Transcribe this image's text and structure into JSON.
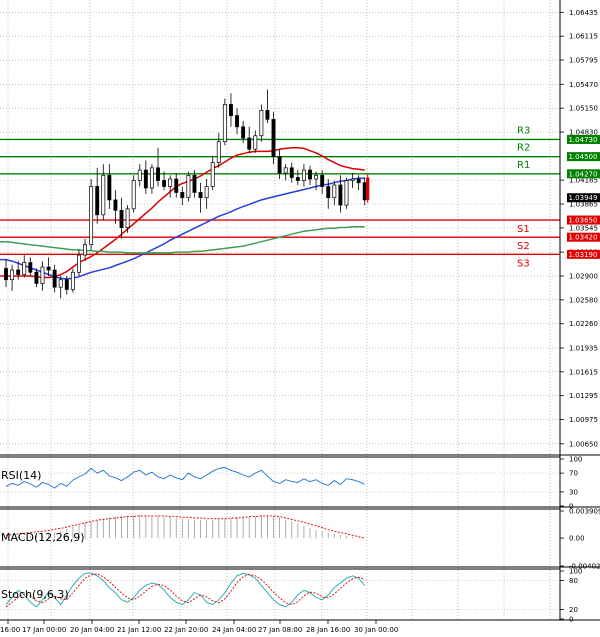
{
  "chart_data": {
    "type": "candlestick",
    "y_axis": {
      "range": [
        1.005,
        1.066
      ],
      "ticks": [
        "1.06435",
        "1.06115",
        "1.05795",
        "1.05470",
        "1.05150",
        "1.04830",
        "1.04185",
        "1.03865",
        "1.03545",
        "1.03220",
        "1.02900",
        "1.02580",
        "1.02260",
        "1.01935",
        "1.01615",
        "1.01295",
        "1.00975",
        "1.00650"
      ]
    },
    "x_axis": {
      "ticks": [
        "16:00",
        "17 Jan 00:00",
        "20 Jan 04:00",
        "21 Jan 12:00",
        "22 Jan 20:00",
        "24 Jan 04:00",
        "27 Jan 08:00",
        "28 Jan 16:00",
        "30 Jan 00:00"
      ]
    },
    "current_price": "1.03949",
    "levels": [
      {
        "name": "R3",
        "value": 1.0473,
        "tag": "1.04730",
        "color": "#008000"
      },
      {
        "name": "R2",
        "value": 1.045,
        "tag": "1.04500",
        "color": "#008000"
      },
      {
        "name": "R1",
        "value": 1.0427,
        "tag": "1.04270",
        "color": "#008000"
      },
      {
        "name": "S1",
        "value": 1.0365,
        "tag": "1.03650",
        "color": "#e00000"
      },
      {
        "name": "S2",
        "value": 1.0342,
        "tag": "1.03420",
        "color": "#e00000"
      },
      {
        "name": "S3",
        "value": 1.0319,
        "tag": "1.03190",
        "color": "#e00000"
      }
    ],
    "candles": [
      [
        1.03,
        1.0312,
        1.0275,
        1.0285
      ],
      [
        1.0285,
        1.0305,
        1.027,
        1.0298
      ],
      [
        1.0298,
        1.031,
        1.0285,
        1.0292
      ],
      [
        1.0292,
        1.0318,
        1.0288,
        1.0308
      ],
      [
        1.0308,
        1.0315,
        1.029,
        1.0295
      ],
      [
        1.0295,
        1.03,
        1.0275,
        1.028
      ],
      [
        1.028,
        1.031,
        1.027,
        1.0302
      ],
      [
        1.0302,
        1.0315,
        1.029,
        1.0298
      ],
      [
        1.0298,
        1.0305,
        1.0268,
        1.0275
      ],
      [
        1.0275,
        1.029,
        1.026,
        1.0285
      ],
      [
        1.0285,
        1.029,
        1.0265,
        1.0272
      ],
      [
        1.0272,
        1.03,
        1.0268,
        1.0295
      ],
      [
        1.0295,
        1.0325,
        1.029,
        1.0318
      ],
      [
        1.0318,
        1.034,
        1.031,
        1.0332
      ],
      [
        1.0332,
        1.042,
        1.0325,
        1.041
      ],
      [
        1.041,
        1.0435,
        1.036,
        1.0372
      ],
      [
        1.0372,
        1.044,
        1.0365,
        1.0425
      ],
      [
        1.0425,
        1.044,
        1.038,
        1.0392
      ],
      [
        1.0392,
        1.0405,
        1.036,
        1.0378
      ],
      [
        1.0378,
        1.0395,
        1.034,
        1.0355
      ],
      [
        1.0355,
        1.0385,
        1.0348,
        1.038
      ],
      [
        1.038,
        1.0425,
        1.0375,
        1.0418
      ],
      [
        1.0418,
        1.044,
        1.041,
        1.0432
      ],
      [
        1.0432,
        1.0445,
        1.04,
        1.0408
      ],
      [
        1.0408,
        1.044,
        1.04,
        1.0435
      ],
      [
        1.0435,
        1.0462,
        1.041,
        1.0418
      ],
      [
        1.0418,
        1.043,
        1.0405,
        1.041
      ],
      [
        1.041,
        1.0425,
        1.0395,
        1.042
      ],
      [
        1.042,
        1.0428,
        1.0395,
        1.0402
      ],
      [
        1.0402,
        1.041,
        1.0385,
        1.0395
      ],
      [
        1.0395,
        1.043,
        1.039,
        1.0425
      ],
      [
        1.0425,
        1.0432,
        1.0395,
        1.0402
      ],
      [
        1.0402,
        1.0415,
        1.0375,
        1.0395
      ],
      [
        1.0395,
        1.042,
        1.038,
        1.041
      ],
      [
        1.041,
        1.045,
        1.0405,
        1.0442
      ],
      [
        1.0442,
        1.0482,
        1.0435,
        1.047
      ],
      [
        1.047,
        1.0528,
        1.0465,
        1.052
      ],
      [
        1.052,
        1.0535,
        1.049,
        1.0505
      ],
      [
        1.0505,
        1.0515,
        1.048,
        1.049
      ],
      [
        1.049,
        1.0498,
        1.0468,
        1.0475
      ],
      [
        1.0475,
        1.049,
        1.0455,
        1.046
      ],
      [
        1.046,
        1.0485,
        1.0455,
        1.0478
      ],
      [
        1.0478,
        1.052,
        1.047,
        1.0512
      ],
      [
        1.0512,
        1.054,
        1.0495,
        1.05
      ],
      [
        1.05,
        1.051,
        1.044,
        1.045
      ],
      [
        1.045,
        1.046,
        1.042,
        1.0428
      ],
      [
        1.0428,
        1.044,
        1.0418,
        1.0435
      ],
      [
        1.0435,
        1.0442,
        1.0415,
        1.0422
      ],
      [
        1.0422,
        1.0432,
        1.0412,
        1.0418
      ],
      [
        1.0418,
        1.044,
        1.041,
        1.0432
      ],
      [
        1.0432,
        1.0438,
        1.0412,
        1.042
      ],
      [
        1.042,
        1.043,
        1.0405,
        1.0425
      ],
      [
        1.0425,
        1.0432,
        1.04,
        1.041
      ],
      [
        1.041,
        1.042,
        1.038,
        1.0395
      ],
      [
        1.0395,
        1.0418,
        1.0385,
        1.0412
      ],
      [
        1.0412,
        1.0425,
        1.0375,
        1.0385
      ],
      [
        1.0385,
        1.0422,
        1.038,
        1.0418
      ],
      [
        1.0418,
        1.0428,
        1.0408,
        1.042
      ],
      [
        1.042,
        1.0425,
        1.0405,
        1.0415
      ],
      [
        1.0415,
        1.0422,
        1.0385,
        1.0392
      ]
    ],
    "moving_averages": [
      {
        "color": "#dd0000",
        "values": [
          1.029,
          1.029,
          1.029,
          1.029,
          1.029,
          1.0289,
          1.0288,
          1.0288,
          1.0289,
          1.0292,
          1.0296,
          1.0302,
          1.0308,
          1.0312,
          1.0316,
          1.0321,
          1.0327,
          1.0333,
          1.0339,
          1.0346,
          1.0353,
          1.036,
          1.0367,
          1.0374,
          1.0381,
          1.0389,
          1.0396,
          1.0403,
          1.041,
          1.0414,
          1.0417,
          1.042,
          1.0424,
          1.0429,
          1.0434,
          1.0438,
          1.0443,
          1.0448,
          1.0452,
          1.0454,
          1.0456,
          1.0457,
          1.0457,
          1.0457,
          1.0458,
          1.046,
          1.0461,
          1.0462,
          1.0462,
          1.0461,
          1.0458,
          1.0455,
          1.0451,
          1.0446,
          1.0442,
          1.0438,
          1.0436,
          1.0434,
          1.0433,
          1.0432
        ]
      },
      {
        "color": "#2a3fdc",
        "values": [
          1.0312,
          1.031,
          1.0307,
          1.0304,
          1.0301,
          1.0298,
          1.0295,
          1.0292,
          1.0289,
          1.0287,
          1.0286,
          1.0287,
          1.0289,
          1.0292,
          1.0295,
          1.0297,
          1.0299,
          1.0301,
          1.0304,
          1.0307,
          1.031,
          1.0313,
          1.0317,
          1.0321,
          1.0325,
          1.0329,
          1.0333,
          1.0338,
          1.0342,
          1.0346,
          1.035,
          1.0354,
          1.0358,
          1.0362,
          1.0366,
          1.037,
          1.0373,
          1.0376,
          1.038,
          1.0383,
          1.0386,
          1.0389,
          1.0392,
          1.0394,
          1.0396,
          1.0398,
          1.04,
          1.0402,
          1.0404,
          1.0406,
          1.0408,
          1.041,
          1.0412,
          1.0413,
          1.0415,
          1.0417,
          1.0418,
          1.042,
          1.0421,
          1.0421
        ]
      },
      {
        "color": "#3e9e56",
        "values": [
          1.0336,
          1.0335,
          1.0334,
          1.0333,
          1.0332,
          1.0331,
          1.033,
          1.0329,
          1.0328,
          1.0327,
          1.0326,
          1.0325,
          1.0325,
          1.0324,
          1.0324,
          1.0323,
          1.0323,
          1.0322,
          1.0322,
          1.0322,
          1.0321,
          1.0321,
          1.0321,
          1.0321,
          1.0321,
          1.0321,
          1.0321,
          1.0321,
          1.0322,
          1.0322,
          1.0322,
          1.0323,
          1.0323,
          1.0324,
          1.0325,
          1.0326,
          1.0327,
          1.0328,
          1.0329,
          1.033,
          1.0332,
          1.0334,
          1.0336,
          1.0338,
          1.034,
          1.0342,
          1.0344,
          1.0346,
          1.0348,
          1.035,
          1.0351,
          1.0352,
          1.0353,
          1.0354,
          1.0354,
          1.0355,
          1.0355,
          1.0356,
          1.0356,
          1.0356
        ]
      }
    ],
    "rsi": {
      "label": "RSI(14)",
      "ticks": [
        "100",
        "70",
        "30",
        "0"
      ],
      "values": [
        42,
        48,
        44,
        52,
        47,
        40,
        50,
        46,
        38,
        48,
        42,
        55,
        62,
        68,
        80,
        70,
        76,
        64,
        60,
        54,
        62,
        72,
        76,
        66,
        72,
        62,
        58,
        66,
        60,
        56,
        70,
        62,
        58,
        66,
        74,
        80,
        82,
        76,
        72,
        66,
        62,
        70,
        76,
        64,
        52,
        48,
        56,
        52,
        50,
        58,
        52,
        56,
        48,
        44,
        54,
        46,
        58,
        56,
        52,
        46
      ]
    },
    "macd": {
      "label": "MACD(12,26,9)",
      "ticks": [
        "0.003909",
        "0.00",
        "-0.004026"
      ],
      "histogram": [
        0.0,
        0.0001,
        0.0002,
        0.0002,
        0.0003,
        0.0004,
        0.0005,
        0.0006,
        0.0008,
        0.001,
        0.0013,
        0.0016,
        0.0019,
        0.0022,
        0.0024,
        0.0026,
        0.0028,
        0.003,
        0.0031,
        0.0032,
        0.0032,
        0.0033,
        0.0033,
        0.0033,
        0.0032,
        0.0032,
        0.0031,
        0.003,
        0.0029,
        0.0028,
        0.0027,
        0.0027,
        0.0026,
        0.0026,
        0.0026,
        0.0027,
        0.0028,
        0.0029,
        0.003,
        0.0031,
        0.0031,
        0.0032,
        0.0033,
        0.0033,
        0.0032,
        0.003,
        0.0027,
        0.0024,
        0.0021,
        0.0018,
        0.0015,
        0.0012,
        0.001,
        0.0008,
        0.0006,
        0.0004,
        0.0003,
        0.0002,
        0.0001,
        0.0
      ],
      "signal": [
        0.0004,
        0.0005,
        0.0006,
        0.0007,
        0.0008,
        0.0009,
        0.001,
        0.0011,
        0.0013,
        0.0014,
        0.0016,
        0.0018,
        0.002,
        0.0022,
        0.0024,
        0.0026,
        0.0027,
        0.0028,
        0.0029,
        0.003,
        0.0031,
        0.0031,
        0.0032,
        0.0032,
        0.0032,
        0.0032,
        0.0032,
        0.0031,
        0.0031,
        0.003,
        0.003,
        0.0029,
        0.0029,
        0.0028,
        0.0028,
        0.0028,
        0.0028,
        0.0029,
        0.0029,
        0.003,
        0.0031,
        0.0031,
        0.0032,
        0.0032,
        0.0032,
        0.0031,
        0.0029,
        0.0027,
        0.0025,
        0.0023,
        0.002,
        0.0018,
        0.0015,
        0.0012,
        0.001,
        0.0008,
        0.0006,
        0.0004,
        0.0002,
        0.0
      ]
    },
    "stoch": {
      "label": "Stoch(9,6,3)",
      "ticks": [
        "100",
        "80",
        "20",
        "0"
      ],
      "k": [
        30,
        45,
        60,
        50,
        35,
        25,
        40,
        55,
        45,
        30,
        50,
        70,
        85,
        95,
        96,
        90,
        80,
        65,
        55,
        40,
        35,
        45,
        60,
        70,
        75,
        72,
        60,
        45,
        35,
        30,
        40,
        55,
        50,
        35,
        30,
        40,
        55,
        75,
        90,
        95,
        92,
        85,
        70,
        55,
        40,
        30,
        25,
        35,
        50,
        60,
        55,
        45,
        40,
        50,
        65,
        75,
        85,
        90,
        85,
        70
      ],
      "d": [
        25,
        35,
        45,
        52,
        48,
        38,
        34,
        42,
        48,
        42,
        40,
        55,
        70,
        85,
        92,
        94,
        88,
        78,
        66,
        54,
        44,
        40,
        48,
        58,
        68,
        72,
        70,
        60,
        48,
        38,
        34,
        42,
        50,
        46,
        38,
        34,
        42,
        58,
        76,
        88,
        93,
        90,
        82,
        70,
        56,
        44,
        34,
        30,
        36,
        48,
        56,
        54,
        46,
        44,
        52,
        64,
        75,
        84,
        87,
        82
      ]
    }
  }
}
